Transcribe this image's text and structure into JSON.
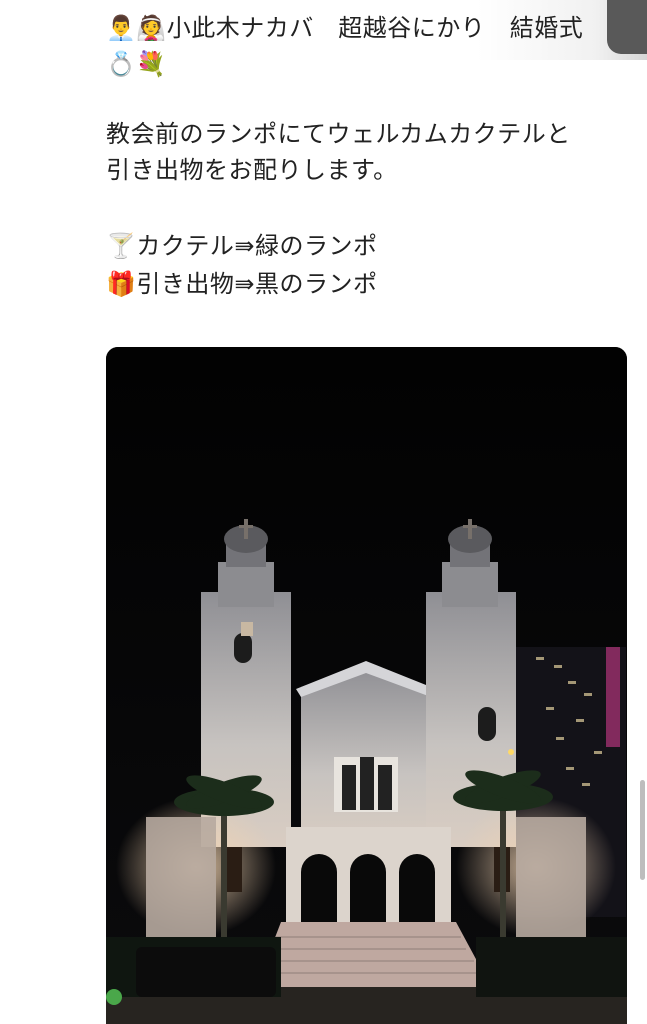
{
  "post": {
    "line_names": "👨‍💼👰小此木ナカバ　超越谷にかり　結婚式",
    "line_ring": "💍💐",
    "line_welcome_1": "教会前のランポにてウェルカムカクテルと",
    "line_welcome_2": "引き出物をお配りします。",
    "line_cocktail": "🍸カクテル⇛緑のランポ",
    "line_gift": "🎁引き出物⇛黒のランポ"
  },
  "media": {
    "alt": "church-at-night"
  },
  "colors": {
    "text": "#222222",
    "background": "#ffffff",
    "corner_tab": "#595959"
  }
}
